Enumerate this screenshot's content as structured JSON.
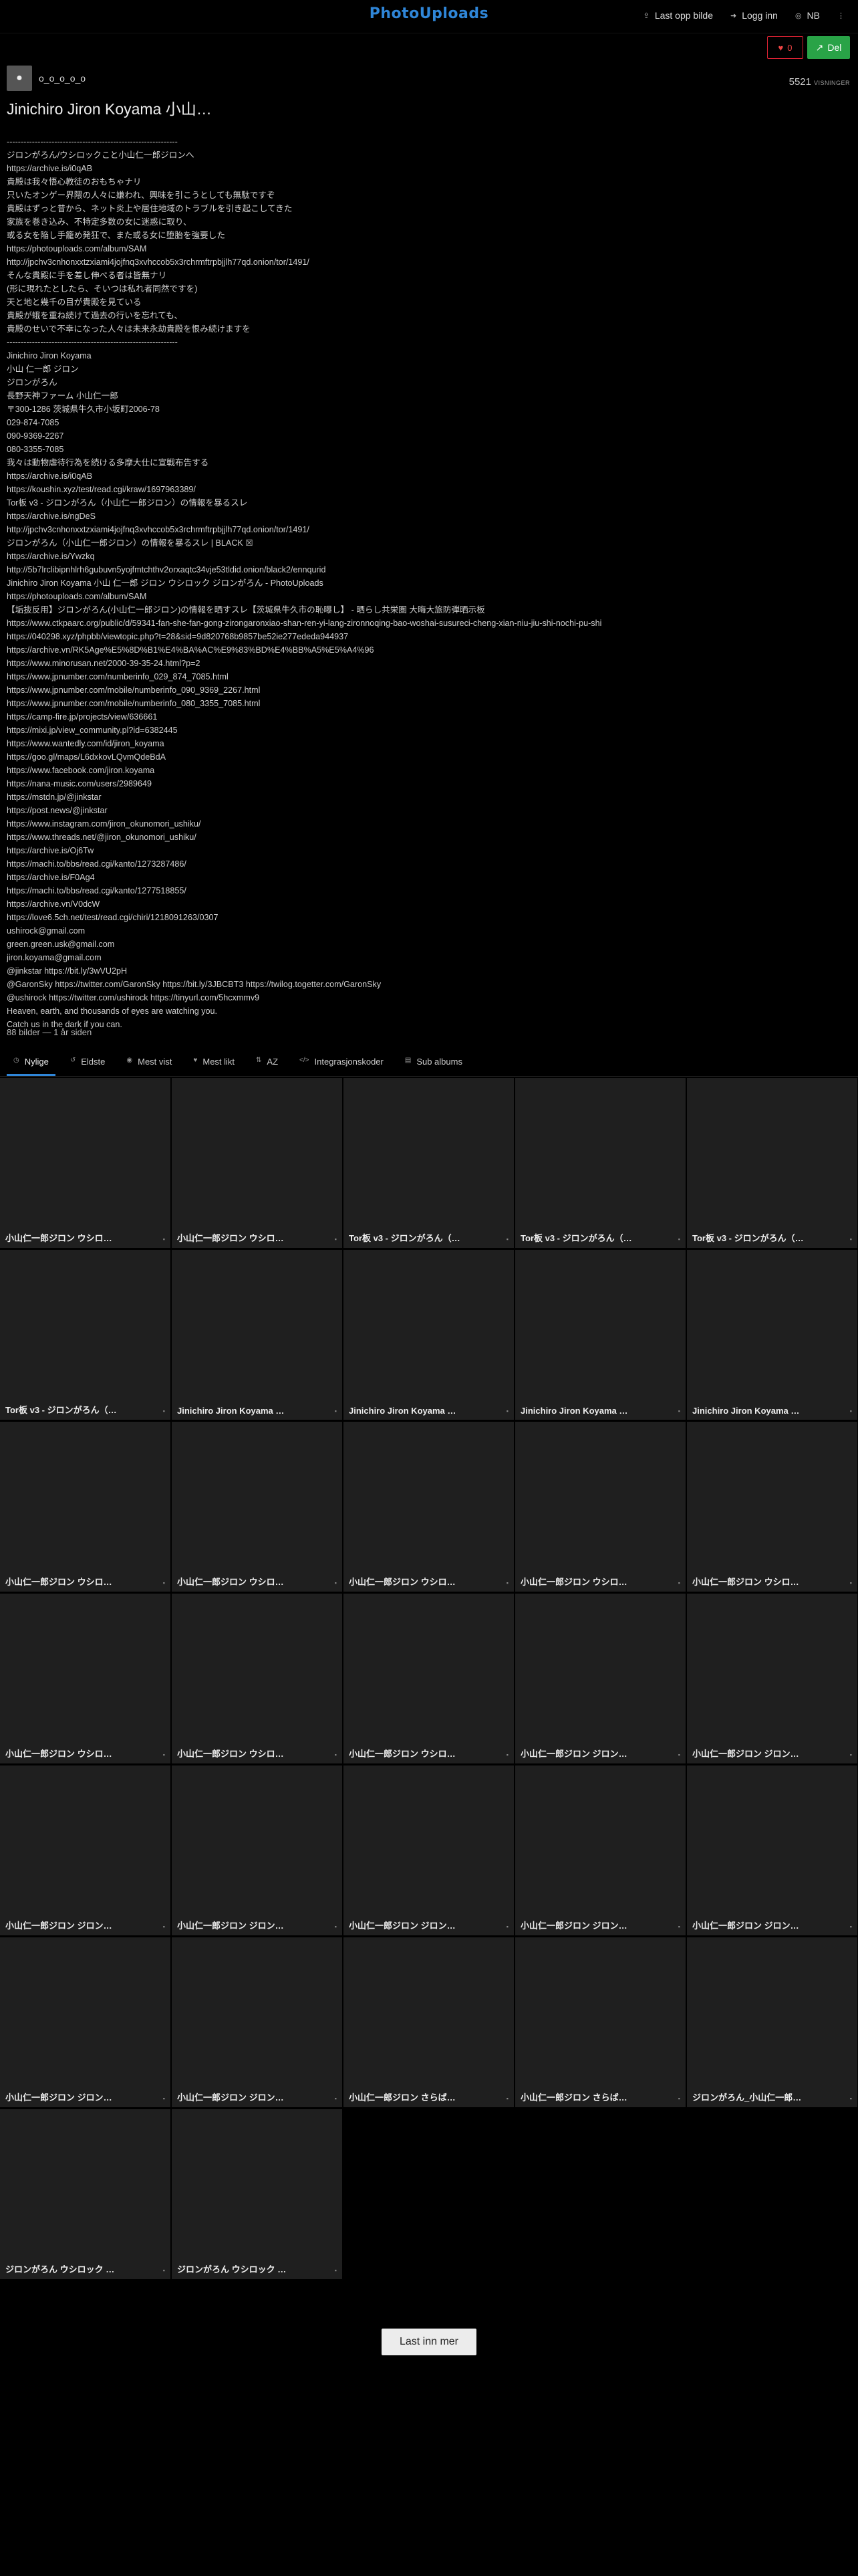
{
  "header": {
    "logo": "PhotoUploads",
    "nav": [
      {
        "icon": "upload-icon",
        "label": "Last opp bilde"
      },
      {
        "icon": "login-icon",
        "label": "Logg inn"
      },
      {
        "icon": "language-icon",
        "label": "NB"
      },
      {
        "icon": "more-icon",
        "label": ""
      }
    ]
  },
  "actions": {
    "like_count": "0",
    "share_label": "Del"
  },
  "owner": {
    "name": "o_o_o_o_o"
  },
  "album": {
    "title": "Jinichiro Jiron Koyama 小山…",
    "views": "5521",
    "views_label": "VISNINGER",
    "description": "-------------------------------------------------------------\nジロンがろん/ウシロックこと小山仁一郎ジロンへ\nhttps://archive.is/i0qAB\n貴殿は我々悟心教徒のおもちゃナリ\n只いたオンゲー界隈の人々に嫌われ、興味を引こうとしても無駄ですぞ\n貴殿はずっと昔から、ネット炎上や居住地域のトラブルを引き起こしてきた\n家族を巻き込み、不特定多数の女に迷惑に取り、\n或る女を陥し手籠め発狂で、また或る女に堕胎を強要した\nhttps://photouploads.com/album/SAM\nhttp://jpchv3cnhonxxtzxiami4jojfnq3xvhccob5x3rchrmftrpbjjlh77qd.onion/tor/1491/\nそんな貴殿に手を差し伸べる者は皆無ナリ\n(形に現れたとしたら、そいつは私れ者同然ですを)\n天と地と幾千の目が貴殿を見ている\n貴殿が蛾を重ね続けて過去の行いを忘れても、\n貴殿のせいで不幸になった人々は未来永劫貴殿を恨み続けますを\n-------------------------------------------------------------\nJinichiro Jiron Koyama\n小山 仁一郎 ジロン\nジロンがろん\n長野天神ファーム 小山仁一郎\n〒300-1286 茨城県牛久市小坂町2006-78\n029-874-7085\n090-9369-2267\n080-3355-7085\n我々は動物虐待行為を続ける多摩大仕に宣戦布告する\nhttps://archive.is/i0qAB\nhttps://koushin.xyz/test/read.cgi/kraw/1697963389/\nTor板 v3 - ジロンがろん（小山仁一郎ジロン）の情報を暴るスレ\nhttps://archive.is/ngDeS\nhttp://jpchv3cnhonxxtzxiami4jojfnq3xvhccob5x3rchrmftrpbjjlh77qd.onion/tor/1491/\nジロンがろん（小山仁一郎ジロン）の情報を暴るスレ | BLACK ☒\nhttps://archive.is/Ywzkq\nhttp://5b7lrclibipnhlrh6gubuvn5yojfmtchthv2orxaqtc34vje53tldid.onion/black2/ennqurid\nJinichiro Jiron Koyama 小山 仁一郎 ジロン ウシロック ジロンがろん - PhotoUploads\nhttps://photouploads.com/album/SAM\n【垢抜反用】ジロンがろん(小山仁一郎ジロン)の情報を晒すスレ【茨城県牛久市の恥曝し】 - 晒らし共栄圏 大晦大旅防弾晒示板\nhttps://www.ctkpaarc.org/public/d/59341-fan-she-fan-gong-zirongaronxiao-shan-ren-yi-lang-zironnoqing-bao-woshai-susureci-cheng-xian-niu-jiu-shi-nochi-pu-shi\nhttps://040298.xyz/phpbb/viewtopic.php?t=28&sid=9d820768b9857be52ie277ededa944937\nhttps://archive.vn/RK5Age%E5%8D%B1%E4%BA%AC%E9%83%BD%E4%BB%A5%E5%A4%96\nhttps://www.minorusan.net/2000-39-35-24.html?p=2\nhttps://www.jpnumber.com/numberinfo_029_874_7085.html\nhttps://www.jpnumber.com/mobile/numberinfo_090_9369_2267.html\nhttps://www.jpnumber.com/mobile/numberinfo_080_3355_7085.html\nhttps://camp-fire.jp/projects/view/636661\nhttps://mixi.jp/view_community.pl?id=6382445\nhttps://www.wantedly.com/id/jiron_koyama\nhttps://goo.gl/maps/L6dxkovLQvmQdeBdA\nhttps://www.facebook.com/jiron.koyama\nhttps://nana-music.com/users/2989649\nhttps://mstdn.jp/@jinkstar\nhttps://post.news/@jinkstar\nhttps://www.instagram.com/jiron_okunomori_ushiku/\nhttps://www.threads.net/@jiron_okunomori_ushiku/\nhttps://archive.is/Oj6Tw\nhttps://machi.to/bbs/read.cgi/kanto/1273287486/\nhttps://archive.is/F0Ag4\nhttps://machi.to/bbs/read.cgi/kanto/1277518855/\nhttps://archive.vn/V0dcW\nhttps://love6.5ch.net/test/read.cgi/chiri/1218091263/0307\nushirock@gmail.com\ngreen.green.usk@gmail.com\njiron.koyama@gmail.com\n@jinkstar https://bit.ly/3wVU2pH\n@GaronSky https://twitter.com/GaronSky https://bit.ly/3JBCBT3 https://twilog.togetter.com/GaronSky\n@ushirock https://twitter.com/ushirock https://tinyurl.com/5hcxmmv9\nHeaven, earth, and thousands of eyes are watching you.\nCatch us in the dark if you can.",
    "meta": "88 bilder — 1 år siden"
  },
  "tabs": [
    {
      "icon": "clock-icon",
      "label": "Nylige",
      "active": true
    },
    {
      "icon": "history-icon",
      "label": "Eldste",
      "active": false
    },
    {
      "icon": "eye-icon",
      "label": "Mest vist",
      "active": false
    },
    {
      "icon": "heart-icon",
      "label": "Mest likt",
      "active": false
    },
    {
      "icon": "sort-alpha-icon",
      "label": "AZ",
      "active": false
    },
    {
      "icon": "code-icon",
      "label": "Integrasjonskoder",
      "active": false
    },
    {
      "icon": "folder-icon",
      "label": "Sub albums",
      "active": false
    }
  ],
  "images": [
    "小山仁一郎ジロン ウシロ…",
    "小山仁一郎ジロン ウシロ…",
    "Tor板 v3 - ジロンがろん（…",
    "Tor板 v3 - ジロンがろん（…",
    "Tor板 v3 - ジロンがろん（…",
    "Tor板 v3 - ジロンがろん（…",
    "Jinichiro Jiron Koyama …",
    "Jinichiro Jiron Koyama …",
    "Jinichiro Jiron Koyama …",
    "Jinichiro Jiron Koyama …",
    "小山仁一郎ジロン ウシロ…",
    "小山仁一郎ジロン ウシロ…",
    "小山仁一郎ジロン ウシロ…",
    "小山仁一郎ジロン ウシロ…",
    "小山仁一郎ジロン ウシロ…",
    "小山仁一郎ジロン ウシロ…",
    "小山仁一郎ジロン ウシロ…",
    "小山仁一郎ジロン ウシロ…",
    "小山仁一郎ジロン ジロン…",
    "小山仁一郎ジロン ジロン…",
    "小山仁一郎ジロン ジロン…",
    "小山仁一郎ジロン ジロン…",
    "小山仁一郎ジロン ジロン…",
    "小山仁一郎ジロン ジロン…",
    "小山仁一郎ジロン ジロン…",
    "小山仁一郎ジロン ジロン…",
    "小山仁一郎ジロン ジロン…",
    "小山仁一郎ジロン さらば…",
    "小山仁一郎ジロン さらば…",
    "ジロンがろん_小山仁一郎…",
    "ジロンがろん ウシロック …",
    "ジロンがろん ウシロック …"
  ],
  "load_more": "Last inn mer",
  "colors": {
    "brand": "#2f86d8",
    "like": "#dd2233",
    "share": "#29a347",
    "tile": "#1f1f1f"
  }
}
